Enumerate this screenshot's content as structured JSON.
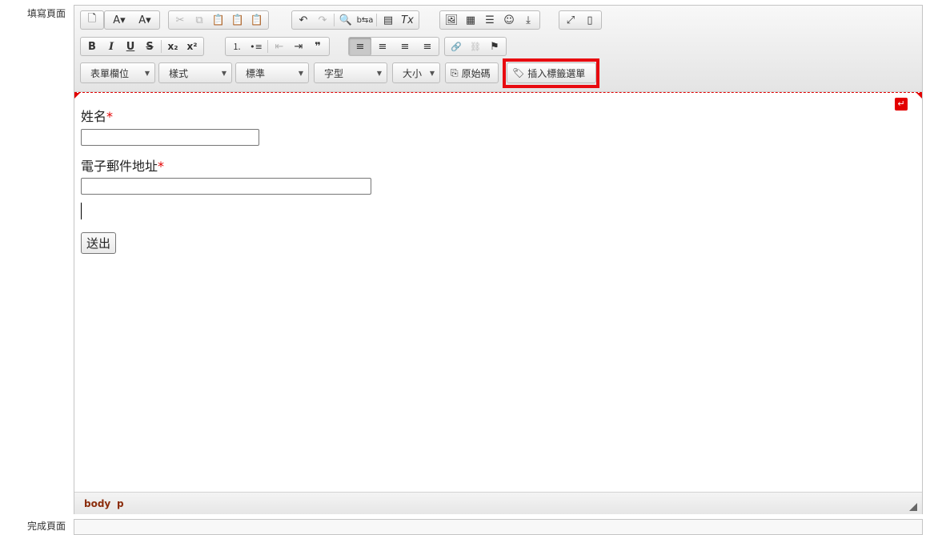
{
  "labels": {
    "editor_field": "填寫頁面",
    "next_field": "完成頁面"
  },
  "toolbar": {
    "row1": [
      {
        "icon": "preview-icon",
        "glyph": "🗋"
      },
      {
        "icon": "text-color-icon",
        "glyph": "A▾"
      },
      {
        "icon": "bg-color-icon",
        "glyph": "A▾"
      },
      {
        "icon": "cut-icon",
        "glyph": "✂"
      },
      {
        "icon": "copy-icon",
        "glyph": "⧉"
      },
      {
        "icon": "paste-icon",
        "glyph": "📋"
      },
      {
        "icon": "paste-text-icon",
        "glyph": "📋"
      },
      {
        "icon": "paste-word-icon",
        "glyph": "📋"
      },
      {
        "icon": "undo-icon",
        "glyph": "↶"
      },
      {
        "icon": "redo-icon",
        "glyph": "↷"
      },
      {
        "icon": "find-icon",
        "glyph": "🔍"
      },
      {
        "icon": "replace-icon",
        "glyph": "b⇆a"
      },
      {
        "icon": "select-all-icon",
        "glyph": "▤"
      },
      {
        "icon": "remove-format-icon",
        "glyph": "Tx"
      },
      {
        "icon": "image-icon",
        "glyph": "🖼"
      },
      {
        "icon": "table-icon",
        "glyph": "▦"
      },
      {
        "icon": "horizontal-rule-icon",
        "glyph": "☰"
      },
      {
        "icon": "smiley-icon",
        "glyph": "☺"
      },
      {
        "icon": "page-break-icon",
        "glyph": "⤓"
      },
      {
        "icon": "maximize-icon",
        "glyph": "⤢"
      },
      {
        "icon": "show-blocks-icon",
        "glyph": "▯"
      }
    ],
    "row2": [
      {
        "icon": "bold-icon",
        "glyph": "B"
      },
      {
        "icon": "italic-icon",
        "glyph": "I"
      },
      {
        "icon": "underline-icon",
        "glyph": "U"
      },
      {
        "icon": "strike-icon",
        "glyph": "S"
      },
      {
        "icon": "subscript-icon",
        "glyph": "x₂"
      },
      {
        "icon": "superscript-icon",
        "glyph": "x²"
      },
      {
        "icon": "numbered-list-icon",
        "glyph": "⒈"
      },
      {
        "icon": "bulleted-list-icon",
        "glyph": "•≡"
      },
      {
        "icon": "outdent-icon",
        "glyph": "⇤"
      },
      {
        "icon": "indent-icon",
        "glyph": "⇥"
      },
      {
        "icon": "blockquote-icon",
        "glyph": "❞"
      },
      {
        "icon": "align-left-icon",
        "glyph": "≡"
      },
      {
        "icon": "align-center-icon",
        "glyph": "≡"
      },
      {
        "icon": "align-right-icon",
        "glyph": "≡"
      },
      {
        "icon": "align-justify-icon",
        "glyph": "≡"
      },
      {
        "icon": "link-icon",
        "glyph": "🔗"
      },
      {
        "icon": "unlink-icon",
        "glyph": "⛓"
      },
      {
        "icon": "anchor-icon",
        "glyph": "⚑"
      }
    ],
    "combos": {
      "form_field": "表單欄位",
      "style": "樣式",
      "format": "標準",
      "font": "字型",
      "size": "大小"
    },
    "source_button": "原始碼",
    "insert_tag_button": "插入標籤選單"
  },
  "form": {
    "name_label": "姓名",
    "email_label": "電子郵件地址",
    "required_mark": "*",
    "submit_label": "送出"
  },
  "statusbar": {
    "path_body": "body",
    "path_p": "p"
  },
  "colors": {
    "highlight": "#e8090f",
    "required": "#e30000",
    "path_text": "#8b2d0c"
  }
}
